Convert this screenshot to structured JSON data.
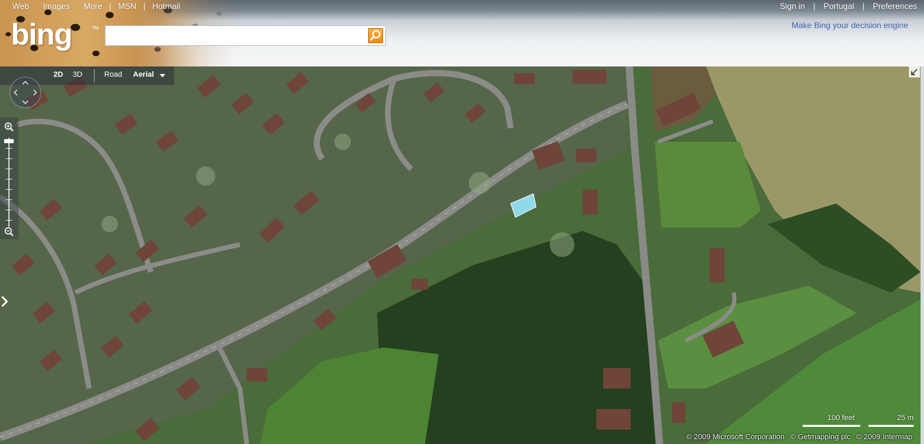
{
  "header": {
    "nav_left": [
      "Web",
      "Images",
      "More",
      "MSN",
      "Hotmail"
    ],
    "nav_right": [
      "Sign in",
      "Portugal",
      "Preferences"
    ],
    "logo": "bing",
    "logo_tm": "TM",
    "tagline": "Make Bing your decision engine",
    "search": {
      "value": "",
      "placeholder": ""
    }
  },
  "map": {
    "view_2d": "2D",
    "view_3d": "3D",
    "style_road": "Road",
    "style_aerial": "Aerial",
    "scale_feet": "100 feet",
    "scale_meters": "25 m",
    "copyright": [
      "© 2009 Microsoft Corporation",
      "© Getmapping plc",
      "© 2009 Intermap"
    ]
  },
  "colors": {
    "tagline": "#3f63b5",
    "search_button": "#f39a1f",
    "grass": "#4d7a3c",
    "field": "#9c9a6a",
    "road": "#8b8c88",
    "roof": "#7a4a3a"
  },
  "icons": [
    "search-icon",
    "compass-icon",
    "zoom-in-icon",
    "zoom-out-icon",
    "expand-panel-icon",
    "collapse-icon"
  ]
}
